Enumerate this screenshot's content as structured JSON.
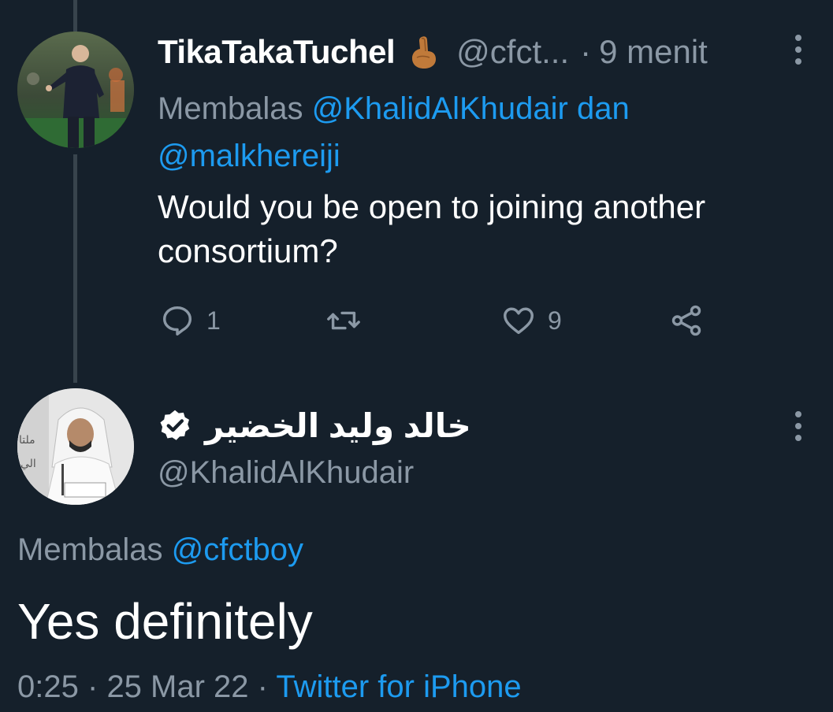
{
  "tweet1": {
    "display_name": "TikaTakaTuchel",
    "emoji": "pinched-fingers-emoji",
    "handle": "@cfct...",
    "separator": "·",
    "time": "9 menit",
    "reply_prefix": "Membalas",
    "reply_mention_1": "@KhalidAlKhudair",
    "reply_joiner": "dan",
    "reply_mention_2": "@malkhereiji",
    "text": "Would you be open to joining another consortium?",
    "actions": {
      "reply_count": "1",
      "retweet_count": "",
      "like_count": "9"
    }
  },
  "tweet2": {
    "display_name": "خالد وليد الخضير",
    "verified": true,
    "handle": "@KhalidAlKhudair",
    "reply_prefix": "Membalas",
    "reply_mention": "@cfctboy",
    "text": "Yes definitely",
    "time": "0:25",
    "separator": "·",
    "date": "25 Mar 22",
    "separator2": "·",
    "source": "Twitter for iPhone"
  },
  "colors": {
    "background": "#15202b",
    "primary_text": "#ffffff",
    "secondary_text": "#8b98a5",
    "accent": "#1d9bf0",
    "thread_line": "#38444d"
  }
}
